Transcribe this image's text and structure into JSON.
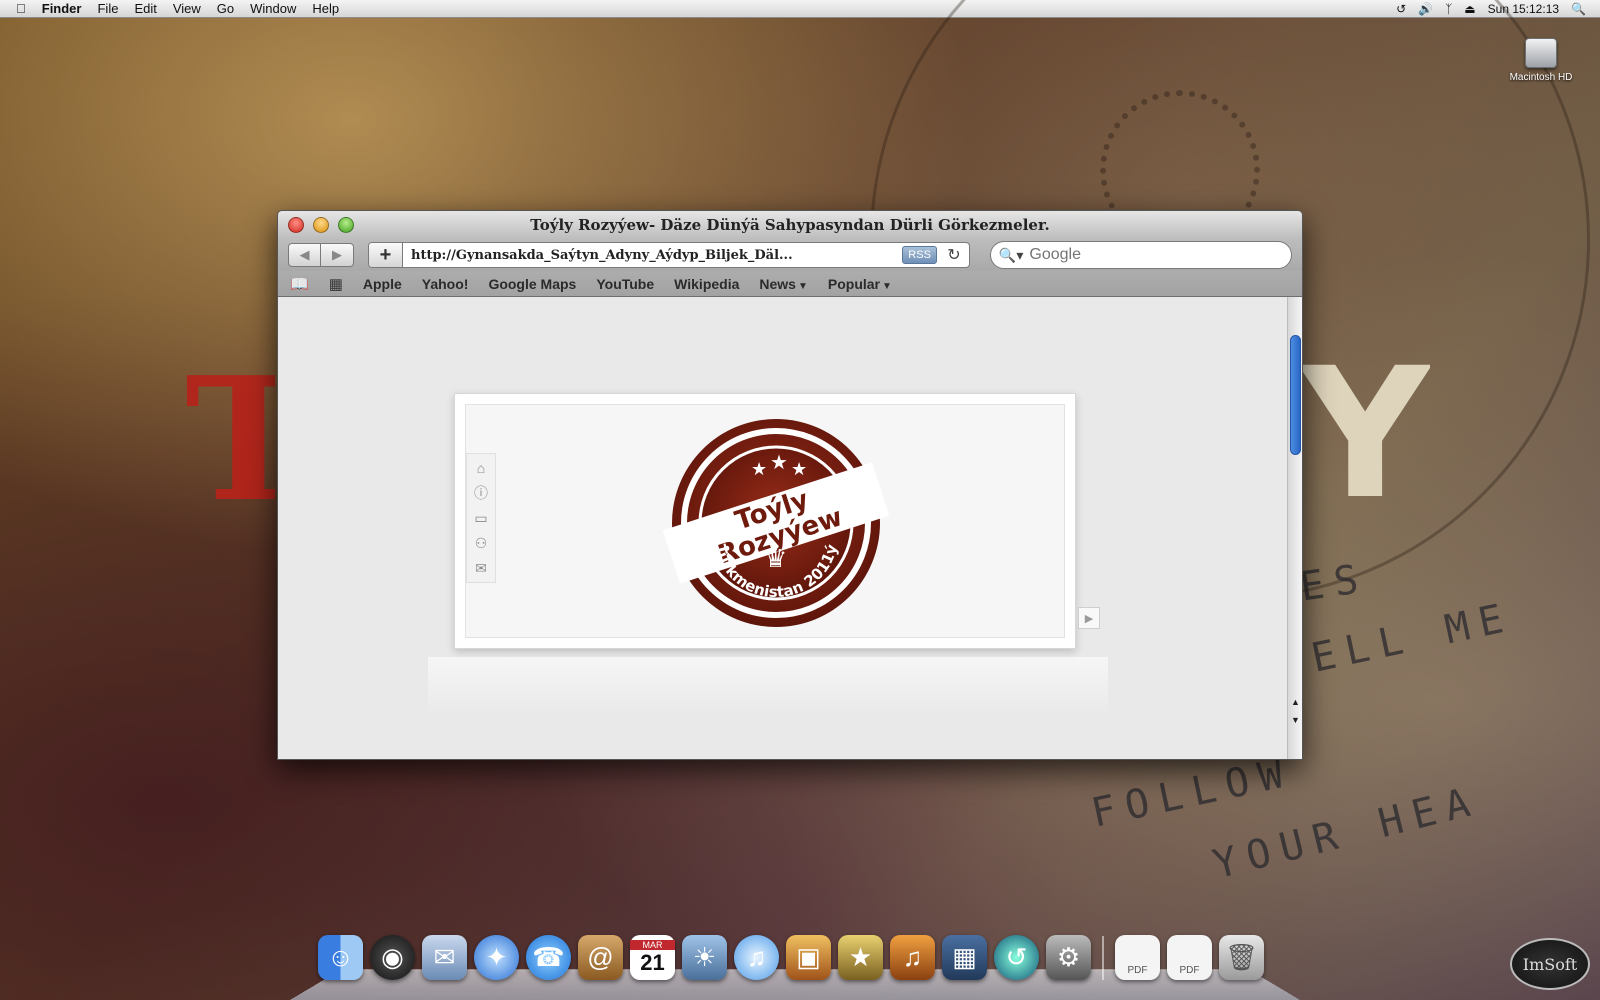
{
  "menubar": {
    "app_name": "Finder",
    "items": [
      "File",
      "Edit",
      "View",
      "Go",
      "Window",
      "Help"
    ],
    "clock": "Sun 15:12:13"
  },
  "desktop": {
    "hd_label": "Macintosh HD",
    "wall_letters": [
      "T",
      "Y"
    ],
    "wall_text_lines": [
      "ES",
      "ELL ME",
      "FOLLOW",
      "YOUR HEA"
    ]
  },
  "browser": {
    "title": "Toýly Rozyýew- Däze Dünýä Sahypasyndan Dürli Görkezmeler.",
    "url": "http://Gynansakda_Saýtyn_Adyny_Aýdyp_Biljek_Däl...",
    "rss_label": "RSS",
    "search_placeholder": "Google",
    "bookmarks": [
      "Apple",
      "Yahoo!",
      "Google Maps",
      "YouTube",
      "Wikipedia"
    ],
    "bookmark_menus": [
      "News",
      "Popular"
    ]
  },
  "logo": {
    "line1": "Toýly",
    "line2": "Rozyýew",
    "arc_text": "Türkmenistan 2011ý",
    "colors": {
      "primary": "#7a1e10",
      "accent": "#ffffff"
    }
  },
  "dock": {
    "items": [
      "Finder",
      "Dashboard",
      "Mail",
      "Safari",
      "iChat",
      "Address Book",
      "iCal",
      "iPhoto",
      "iTunes",
      "Preview",
      "iMovie",
      "GarageBand",
      "Spaces",
      "Time Machine",
      "System Preferences"
    ],
    "calendar_month": "MAR",
    "calendar_day": "21",
    "doc_label": "PDF"
  },
  "watermark": "ImSoft"
}
